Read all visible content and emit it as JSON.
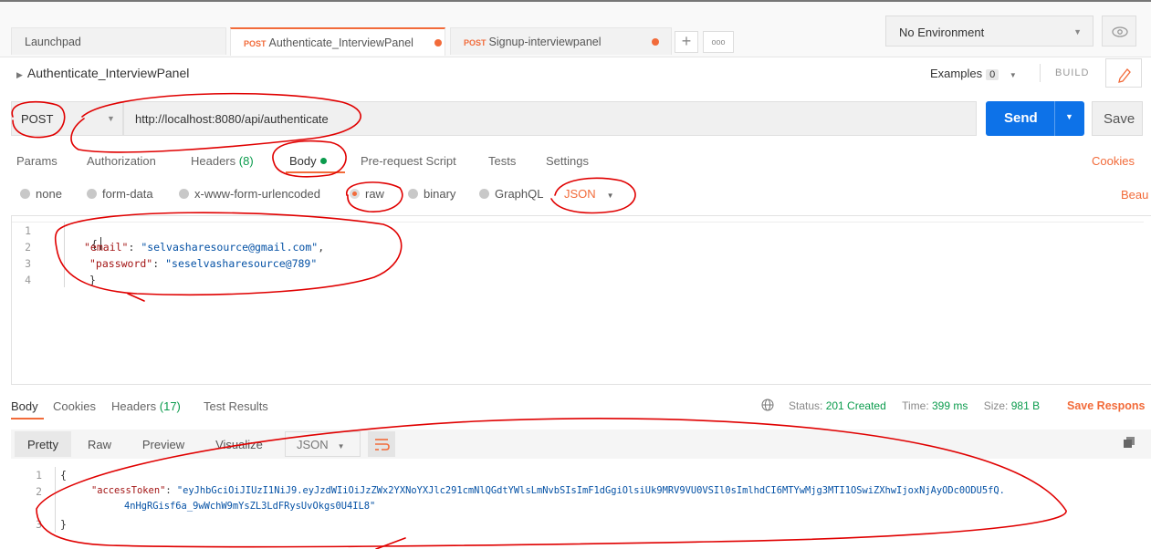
{
  "tabs": [
    {
      "label": "Launchpad"
    },
    {
      "method": "POST",
      "label": "Authenticate_InterviewPanel"
    },
    {
      "method": "POST",
      "label": "Signup-interviewpanel"
    }
  ],
  "new_tab": "+",
  "more_tabs": "ooo",
  "environment": {
    "selected": "No Environment"
  },
  "request": {
    "title": "Authenticate_InterviewPanel",
    "examples_label": "Examples",
    "examples_count": "0",
    "build_label": "BUILD",
    "method": "POST",
    "url": "http://localhost:8080/api/authenticate",
    "send_label": "Send",
    "save_label": "Save"
  },
  "request_tabs": {
    "params": "Params",
    "authorization": "Authorization",
    "headers": "Headers",
    "headers_count": "(8)",
    "body": "Body",
    "prerequest": "Pre-request Script",
    "tests": "Tests",
    "settings": "Settings",
    "cookies": "Cookies"
  },
  "body_types": {
    "none": "none",
    "form_data": "form-data",
    "urlencoded": "x-www-form-urlencoded",
    "raw": "raw",
    "binary": "binary",
    "graphql": "GraphQL",
    "format": "JSON",
    "beautify": "Beau"
  },
  "editor": {
    "line_numbers": [
      "1",
      "2",
      "3",
      "4"
    ],
    "open": "{",
    "email_key": "\"email\"",
    "email_value": "\"selvasharesource@gmail.com\"",
    "password_key": "\"password\"",
    "password_value": "\"seselvasharesource@789\"",
    "close": "}"
  },
  "response": {
    "tabs": {
      "body": "Body",
      "cookies": "Cookies",
      "headers": "Headers",
      "headers_count": "(17)",
      "test_results": "Test Results"
    },
    "status_label": "Status:",
    "status_value": "201 Created",
    "time_label": "Time:",
    "time_value": "399 ms",
    "size_label": "Size:",
    "size_value": "981 B",
    "save_response": "Save Respons",
    "view_modes": {
      "pretty": "Pretty",
      "raw": "Raw",
      "preview": "Preview",
      "visualize": "Visualize"
    },
    "format": "JSON",
    "line_numbers": [
      "1",
      "2",
      "3"
    ],
    "open": "{",
    "token_key": "\"accessToken\"",
    "token_value_line1": "\"eyJhbGciOiJIUzI1NiJ9.eyJzdWIiOiJzZWx2YXNoYXJlc291cmNlQGdtYWlsLmNvbSIsImF1dGgiOlsiUk9MRV9VU0VSIl0sImlhdCI6MTYwMjg3MTI1OSwiZXhwIjoxNjAyODc0ODU5fQ.",
    "token_value_line2": "4nHgRGisf6a_9wWchW9mYsZL3LdFRysUvOkgs0U4IL8\"",
    "close": "}"
  },
  "colors": {
    "accent": "#f26b3a",
    "send": "#0d72e8",
    "status_ok": "#0a9b4c",
    "annotation": "#e00000"
  }
}
